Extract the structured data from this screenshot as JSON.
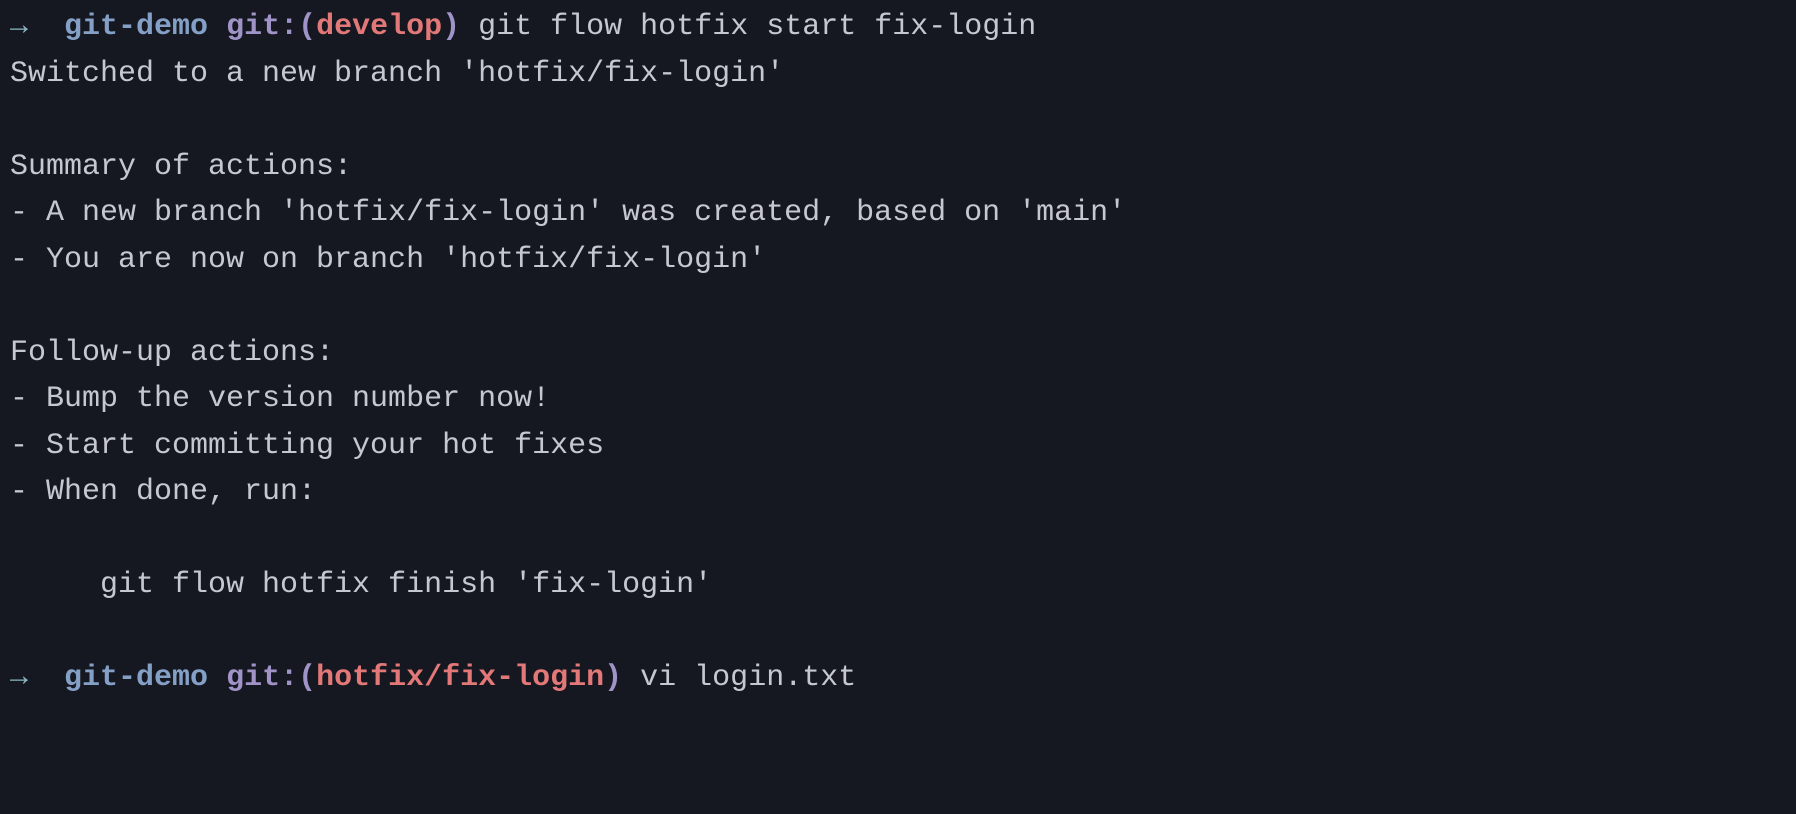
{
  "prompt1": {
    "arrow": "→",
    "dir": "git-demo",
    "git_label": "git:(",
    "branch": "develop",
    "close_paren": ")",
    "command": "git flow hotfix start fix-login"
  },
  "output": {
    "line1": "Switched to a new branch 'hotfix/fix-login'",
    "blank1": "",
    "line2": "Summary of actions:",
    "line3": "- A new branch 'hotfix/fix-login' was created, based on 'main'",
    "line4": "- You are now on branch 'hotfix/fix-login'",
    "blank2": "",
    "line5": "Follow-up actions:",
    "line6": "- Bump the version number now!",
    "line7": "- Start committing your hot fixes",
    "line8": "- When done, run:",
    "blank3": "",
    "line9": "     git flow hotfix finish 'fix-login'",
    "blank4": ""
  },
  "prompt2": {
    "arrow": "→",
    "dir": "git-demo",
    "git_label": "git:(",
    "branch": "hotfix/fix-login",
    "close_paren": ")",
    "command": "vi login.txt"
  }
}
